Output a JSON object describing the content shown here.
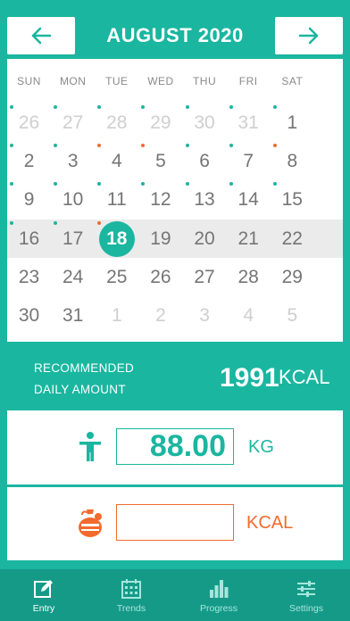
{
  "header": {
    "title": "AUGUST 2020",
    "prev_icon": "arrow-left-icon",
    "next_icon": "arrow-right-icon"
  },
  "calendar": {
    "weekdays": [
      "SUN",
      "MON",
      "TUE",
      "WED",
      "THU",
      "FRI",
      "SAT"
    ],
    "selected_day": "18",
    "weeks": [
      [
        {
          "day": "26",
          "muted": true,
          "dot": "teal"
        },
        {
          "day": "27",
          "muted": true,
          "dot": "teal"
        },
        {
          "day": "28",
          "muted": true,
          "dot": "teal"
        },
        {
          "day": "29",
          "muted": true,
          "dot": "teal"
        },
        {
          "day": "30",
          "muted": true,
          "dot": "teal"
        },
        {
          "day": "31",
          "muted": true,
          "dot": "teal"
        },
        {
          "day": "1",
          "muted": false,
          "dot": "teal"
        }
      ],
      [
        {
          "day": "2",
          "muted": false,
          "dot": "teal"
        },
        {
          "day": "3",
          "muted": false,
          "dot": "teal"
        },
        {
          "day": "4",
          "muted": false,
          "dot": "orange"
        },
        {
          "day": "5",
          "muted": false,
          "dot": "orange"
        },
        {
          "day": "6",
          "muted": false,
          "dot": "teal"
        },
        {
          "day": "7",
          "muted": false,
          "dot": "teal"
        },
        {
          "day": "8",
          "muted": false,
          "dot": "orange"
        }
      ],
      [
        {
          "day": "9",
          "muted": false,
          "dot": "teal"
        },
        {
          "day": "10",
          "muted": false,
          "dot": "teal"
        },
        {
          "day": "11",
          "muted": false,
          "dot": "teal"
        },
        {
          "day": "12",
          "muted": false,
          "dot": "teal"
        },
        {
          "day": "13",
          "muted": false,
          "dot": "teal"
        },
        {
          "day": "14",
          "muted": false,
          "dot": "teal"
        },
        {
          "day": "15",
          "muted": false,
          "dot": "teal"
        }
      ],
      [
        {
          "day": "16",
          "muted": false,
          "dot": "teal"
        },
        {
          "day": "17",
          "muted": false,
          "dot": "teal"
        },
        {
          "day": "18",
          "muted": false,
          "dot": "orange",
          "selected": true
        },
        {
          "day": "19",
          "muted": false,
          "dot": ""
        },
        {
          "day": "20",
          "muted": false,
          "dot": ""
        },
        {
          "day": "21",
          "muted": false,
          "dot": ""
        },
        {
          "day": "22",
          "muted": false,
          "dot": ""
        }
      ],
      [
        {
          "day": "23",
          "muted": false,
          "dot": ""
        },
        {
          "day": "24",
          "muted": false,
          "dot": ""
        },
        {
          "day": "25",
          "muted": false,
          "dot": ""
        },
        {
          "day": "26",
          "muted": false,
          "dot": ""
        },
        {
          "day": "27",
          "muted": false,
          "dot": ""
        },
        {
          "day": "28",
          "muted": false,
          "dot": ""
        },
        {
          "day": "29",
          "muted": false,
          "dot": ""
        }
      ],
      [
        {
          "day": "30",
          "muted": false,
          "dot": ""
        },
        {
          "day": "31",
          "muted": false,
          "dot": ""
        },
        {
          "day": "1",
          "muted": true,
          "dot": ""
        },
        {
          "day": "2",
          "muted": true,
          "dot": ""
        },
        {
          "day": "3",
          "muted": true,
          "dot": ""
        },
        {
          "day": "4",
          "muted": true,
          "dot": ""
        },
        {
          "day": "5",
          "muted": true,
          "dot": ""
        }
      ]
    ]
  },
  "recommended": {
    "label_line1": "RECOMMENDED",
    "label_line2": "DAILY AMOUNT",
    "value": "1991",
    "unit": "KCAL"
  },
  "weight": {
    "icon": "person-icon",
    "value": "88.00",
    "unit": "KG"
  },
  "kcal": {
    "icon": "food-bag-icon",
    "value": "",
    "unit": "KCAL"
  },
  "tabs": [
    {
      "label": "Entry",
      "icon": "pencil-icon",
      "active": true
    },
    {
      "label": "Trends",
      "icon": "calendar-grid-icon",
      "active": false
    },
    {
      "label": "Progress",
      "icon": "bar-chart-icon",
      "active": false
    },
    {
      "label": "Settings",
      "icon": "sliders-icon",
      "active": false
    }
  ],
  "colors": {
    "primary": "#1ab6a0",
    "accent": "#f26a2e",
    "tabbar": "#159a88"
  }
}
